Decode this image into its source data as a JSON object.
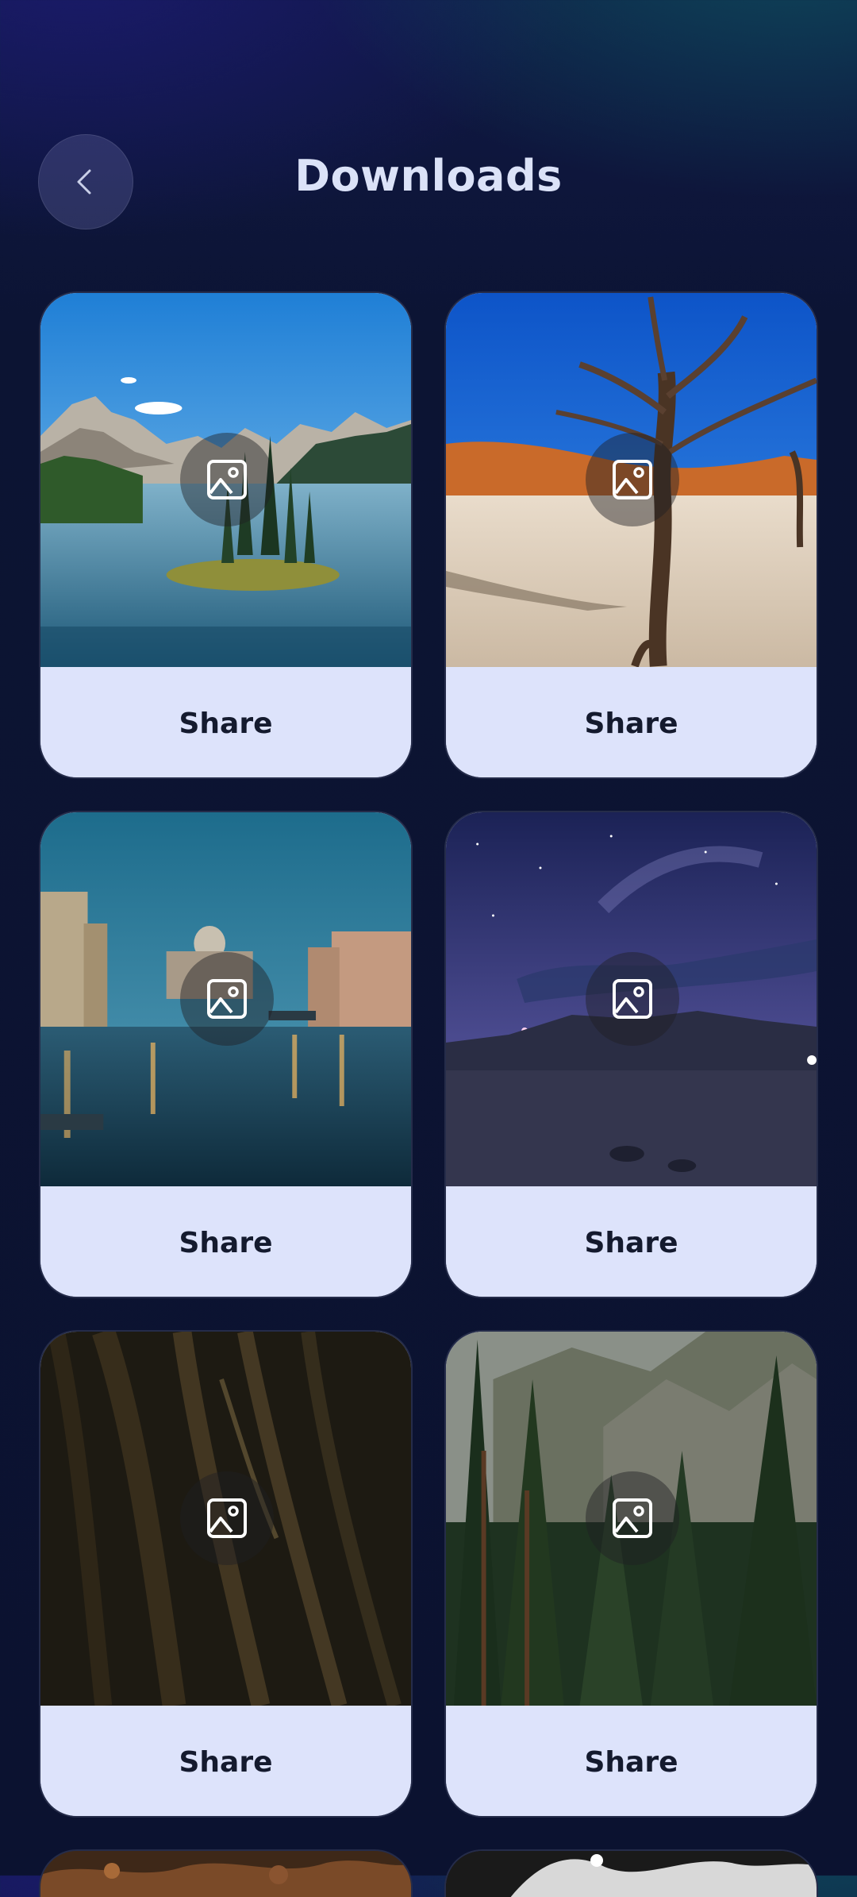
{
  "header": {
    "title": "Downloads",
    "back_icon": "chevron-left-icon"
  },
  "downloads": [
    {
      "share_label": "Share",
      "icon": "image-icon"
    },
    {
      "share_label": "Share",
      "icon": "image-icon"
    },
    {
      "share_label": "Share",
      "icon": "image-icon"
    },
    {
      "share_label": "Share",
      "icon": "image-icon"
    },
    {
      "share_label": "Share",
      "icon": "image-icon"
    },
    {
      "share_label": "Share",
      "icon": "image-icon"
    }
  ],
  "colors": {
    "background": "#0b1230",
    "card": "#dde3fb",
    "title": "#dbe2f8",
    "share_text": "#141a2e"
  }
}
